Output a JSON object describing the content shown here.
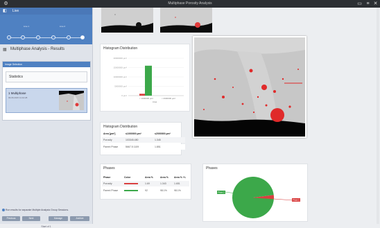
{
  "window": {
    "title": "Multiphase Porosity Analysis"
  },
  "sidebar": {
    "header": "Live",
    "steps": [
      {
        "top": "Live 1",
        "bottom": ""
      },
      {
        "top": "Live 2",
        "bottom": ""
      }
    ],
    "results_title": "Multiphase Analysis - Results",
    "image_selection": {
      "title": "Image Selection",
      "statistics_label": "Statistics",
      "item_title": "1 Multiphase",
      "item_sub": "09.06.2015 11:42:28"
    },
    "hint": "Run results for separate Multiple Analysis Group Sessions.",
    "buttons": [
      "Previous",
      "Next",
      "Manage",
      "Archive"
    ],
    "footer": "Start of 1"
  },
  "histogram_panel": {
    "title": "Histogram Distribution",
    "y_ticks": [
      "20000000 µm²",
      "15000000 µm²",
      "10000000 µm²",
      "5000000 µm²",
      "0 µm²"
    ],
    "x_labels": [
      "< 1000000 µm²",
      "< 2000000 µm²",
      "Area"
    ],
    "bar_colors": {
      "phase1": "#d94040",
      "phase2": "#3ca84a"
    }
  },
  "chart_data": [
    {
      "type": "bar",
      "title": "Histogram Distribution",
      "categories": [
        "< 1000000 µm²",
        "< 2000000 µm²"
      ],
      "series": [
        {
          "name": "Phase 1",
          "values": [
            1000000,
            0
          ]
        },
        {
          "name": "Phase 2",
          "values": [
            16000000,
            0
          ]
        }
      ],
      "xlabel": "Area",
      "ylim": [
        0,
        20000000
      ]
    },
    {
      "type": "pie",
      "title": "Phases",
      "categories": [
        "Phase 1",
        "Phase 2"
      ],
      "values": [
        3,
        97
      ],
      "colors": [
        "#d94040",
        "#3ca84a"
      ]
    }
  ],
  "hist_table": {
    "title": "Histogram Distribution",
    "headers": [
      "Area [µm²]",
      "≤1000000 µm²",
      "≤2000000 µm²"
    ],
    "rows": [
      [
        "Porosity",
        "103345.480",
        "1.345"
      ],
      [
        "Parent Phase",
        "5667.5 1109",
        "1.851"
      ]
    ]
  },
  "phases_table": {
    "title": "Phases",
    "headers": [
      "Phase",
      "Color",
      "Area %",
      "Area %",
      "Area % +/-"
    ],
    "rows": [
      {
        "name": "Porosity",
        "color": "#d94040",
        "v1": "1.69",
        "v2": "1.343",
        "v3": "1.651"
      },
      {
        "name": "Parent Phase",
        "color": "#3ca84a",
        "v1": "92",
        "v2": "98.1%",
        "v3": "98.1%"
      }
    ]
  },
  "pie_panel": {
    "title": "Phases",
    "label_green": "Phase 2",
    "label_red": "Phase 1"
  }
}
